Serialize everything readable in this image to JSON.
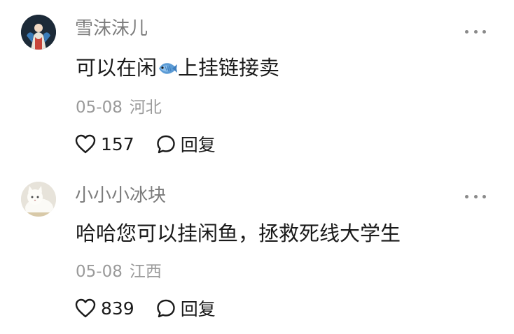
{
  "comments": [
    {
      "username": "雪沫沫儿",
      "text_before": "可以在闲",
      "emoji": "fish-emoji",
      "text_after": "上挂链接卖",
      "date": "05-08",
      "location": "河北",
      "likes": "157",
      "reply_label": "回复"
    },
    {
      "username": "小小小冰块",
      "text": "哈哈您可以挂闲鱼，拯救死线大学生",
      "date": "05-08",
      "location": "江西",
      "likes": "839",
      "reply_label": "回复"
    }
  ],
  "icons": {
    "like": "heart-outline-icon",
    "reply": "speech-bubble-icon",
    "more": "more-dots-icon"
  }
}
